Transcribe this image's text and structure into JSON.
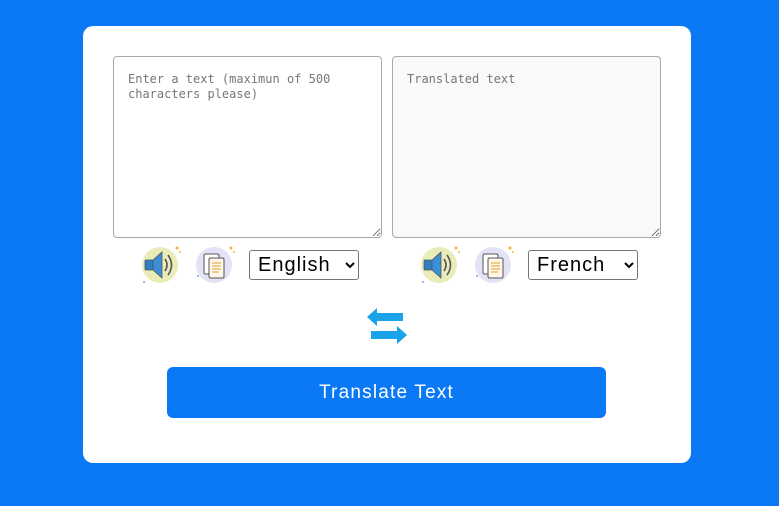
{
  "source": {
    "placeholder": "Enter a text (maximun of 500 characters please)",
    "value": "",
    "language": "English",
    "language_options": [
      "English",
      "French"
    ]
  },
  "target": {
    "placeholder": "Translated text",
    "value": "",
    "language": "French",
    "language_options": [
      "English",
      "French"
    ]
  },
  "icons": {
    "speak": "speaker-icon",
    "copy": "copy-icon",
    "swap": "swap-arrows-icon"
  },
  "actions": {
    "translate_label": "Translate Text"
  },
  "colors": {
    "background": "#0b78f6",
    "accent": "#0b78f6",
    "swap_icon": "#1aa3e8"
  }
}
